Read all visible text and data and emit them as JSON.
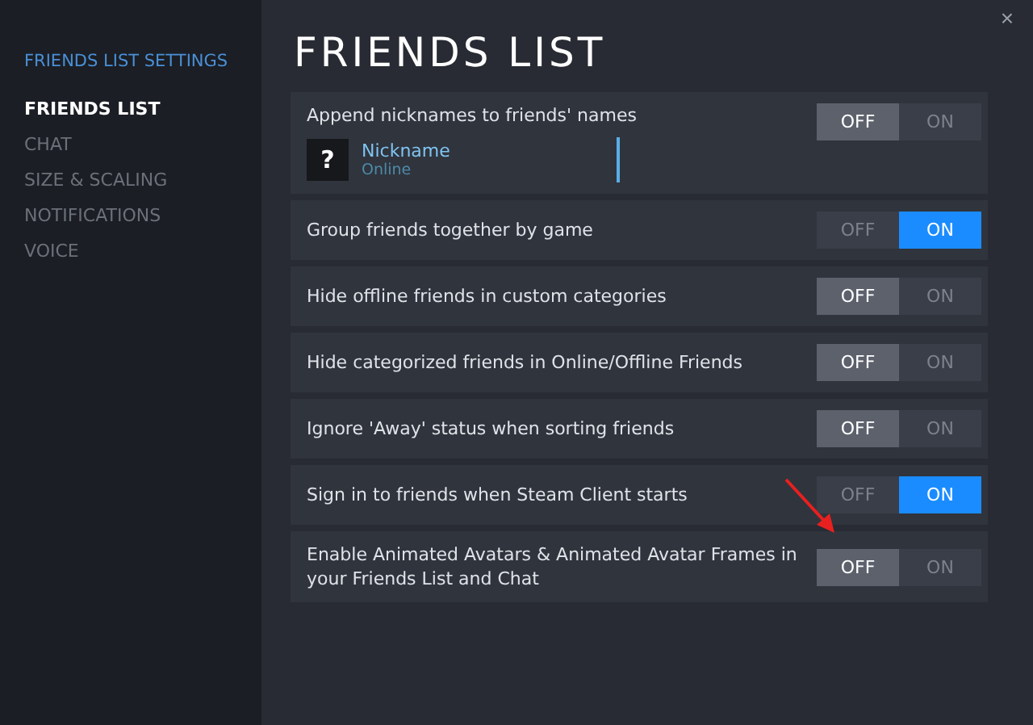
{
  "window": {
    "close": "×"
  },
  "sidebar": {
    "heading": "FRIENDS LIST SETTINGS",
    "items": [
      {
        "label": "FRIENDS LIST",
        "selected": true
      },
      {
        "label": "CHAT",
        "selected": false
      },
      {
        "label": "SIZE & SCALING",
        "selected": false
      },
      {
        "label": "NOTIFICATIONS",
        "selected": false
      },
      {
        "label": "VOICE",
        "selected": false
      }
    ]
  },
  "title": "FRIENDS LIST",
  "settings": [
    {
      "label": "Append nicknames to friends' names",
      "off": "OFF",
      "on": "ON",
      "value": false,
      "preview": {
        "avatar": "?",
        "name": "Nickname",
        "status": "Online"
      }
    },
    {
      "label": "Group friends together by game",
      "off": "OFF",
      "on": "ON",
      "value": true
    },
    {
      "label": "Hide offline friends in custom categories",
      "off": "OFF",
      "on": "ON",
      "value": false
    },
    {
      "label": "Hide categorized friends in Online/Offline Friends",
      "off": "OFF",
      "on": "ON",
      "value": false
    },
    {
      "label": "Ignore 'Away' status when sorting friends",
      "off": "OFF",
      "on": "ON",
      "value": false
    },
    {
      "label": "Sign in to friends when Steam Client starts",
      "off": "OFF",
      "on": "ON",
      "value": true
    },
    {
      "label": "Enable Animated Avatars & Animated Avatar Frames in your Friends List and Chat",
      "off": "OFF",
      "on": "ON",
      "value": false
    }
  ]
}
